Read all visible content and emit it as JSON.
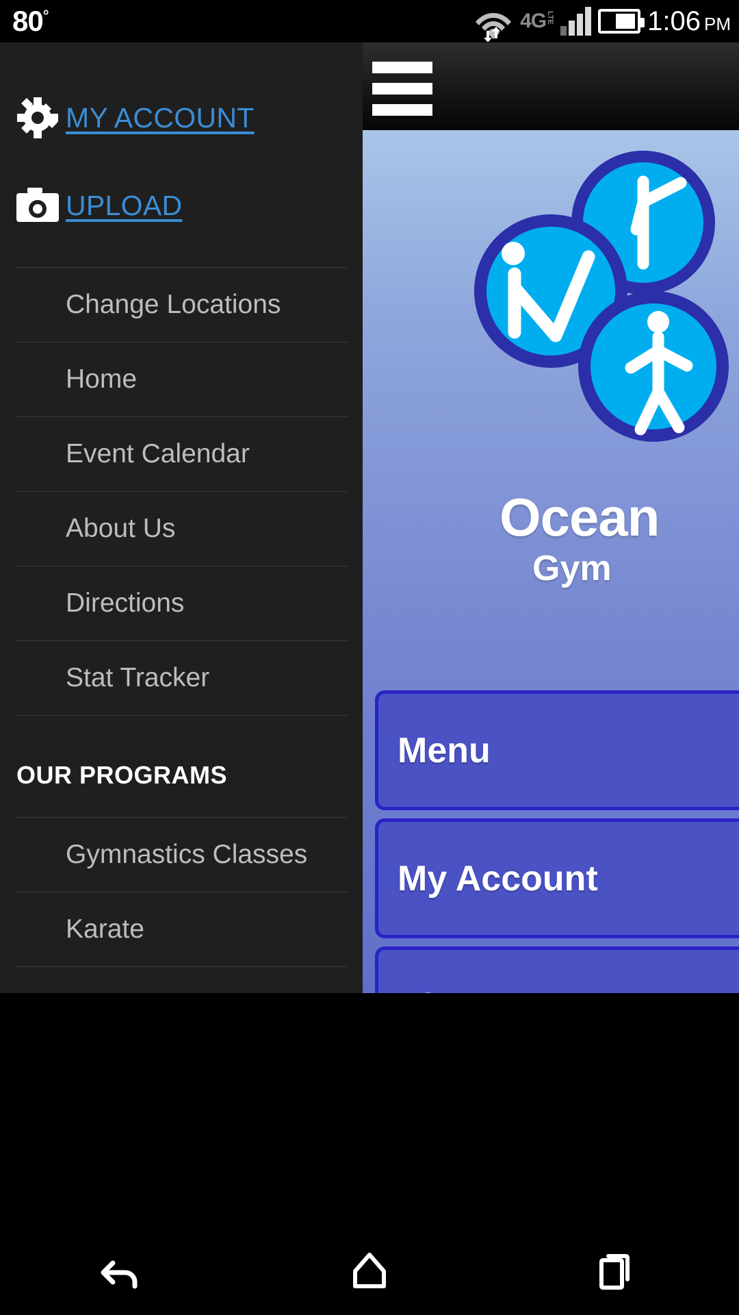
{
  "status_bar": {
    "temperature": "80",
    "degree_symbol": "°",
    "network_label": "4G",
    "network_sub": "LTE",
    "time": "1:06",
    "meridiem": "PM",
    "icons": [
      "wifi-icon",
      "signal-bars-icon",
      "battery-icon"
    ]
  },
  "drawer": {
    "quick_links": [
      {
        "label": "MY ACCOUNT",
        "icon": "gear-icon"
      },
      {
        "label": "UPLOAD",
        "icon": "camera-icon"
      }
    ],
    "nav_items": [
      "Change Locations",
      "Home",
      "Event Calendar",
      "About Us",
      "Directions",
      "Stat Tracker"
    ],
    "section_title": "OUR PROGRAMS",
    "program_items": [
      "Gymnastics Classes",
      "Karate"
    ],
    "link_color": "#3b8dd4",
    "background": "#1f1f1f"
  },
  "content": {
    "menu_icon": "hamburger-menu-icon",
    "brand_name": "Ocean",
    "brand_sub": "Gym",
    "logo_icon": "gymnast-clover-logo-icon",
    "buttons": [
      "Menu",
      "My Account",
      "Classes"
    ],
    "button_fill": "#4a52c4",
    "button_border": "#2a22c6"
  },
  "system_nav": {
    "back": "back-icon",
    "home": "home-icon",
    "recents": "recents-icon"
  }
}
